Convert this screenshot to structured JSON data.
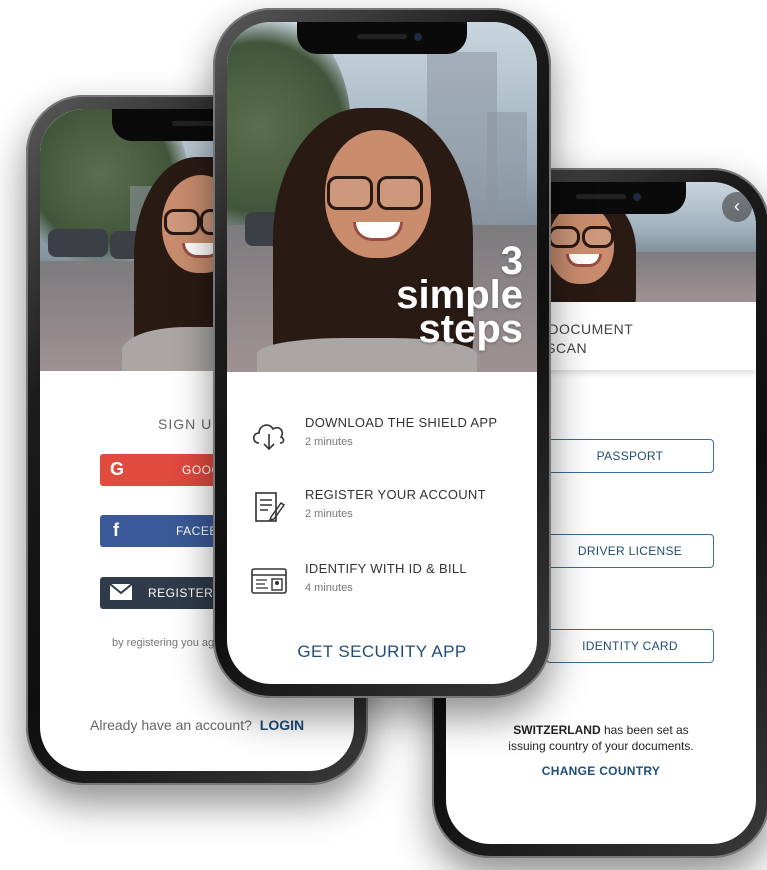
{
  "left_phone": {
    "signup_title": "SIGN UP",
    "google_label": "GOOG",
    "facebook_label": "FACEBO",
    "register_label": "REGISTER W",
    "disclaimer": "by registering you ag",
    "already_text": "Already have an account?",
    "login_link": "LOGIN",
    "icons": {
      "google": "google-icon",
      "facebook": "facebook-icon",
      "mail": "mail-icon"
    },
    "colors": {
      "google": "#e04a3f",
      "facebook": "#3b5998",
      "register": "#2f3b4a"
    }
  },
  "center_phone": {
    "hero_line1": "3",
    "hero_line2": "simple",
    "hero_line3": "steps",
    "steps": [
      {
        "title": "DOWNLOAD THE SHIELD APP",
        "duration": "2 minutes",
        "icon": "cloud-download-icon"
      },
      {
        "title": "REGISTER YOUR ACCOUNT",
        "duration": "2 minutes",
        "icon": "edit-document-icon"
      },
      {
        "title": "IDENTIFY WITH ID & BILL",
        "duration": "4 minutes",
        "icon": "id-card-icon"
      }
    ],
    "cta": "GET SECURITY APP",
    "colors": {
      "accent": "#1f4d78"
    }
  },
  "right_phone": {
    "header_line1": "HE TYPE OF DOCUMENT",
    "header_line2": "U WANT TO SCAN",
    "back_icon": "chevron-left-icon",
    "back_glyph": "‹",
    "doc_buttons": [
      "PASSPORT",
      "DRIVER LICENSE",
      "IDENTITY CARD"
    ],
    "country_bold": "SWITZERLAND",
    "country_rest": " has been set as",
    "country_line2": "issuing country of your documents.",
    "change_country": "CHANGE COUNTRY"
  }
}
